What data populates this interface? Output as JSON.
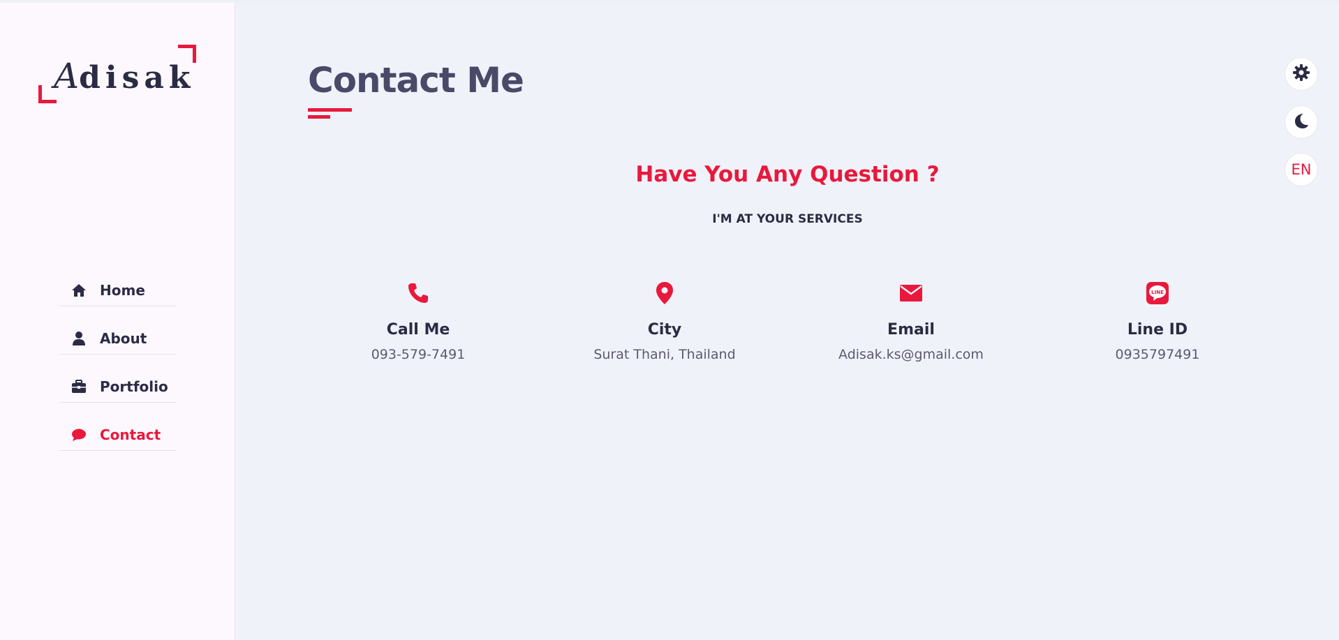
{
  "logo": {
    "first": "A",
    "rest": "disak"
  },
  "nav": [
    {
      "label": "Home",
      "icon": "home-icon",
      "active": false
    },
    {
      "label": "About",
      "icon": "user-icon",
      "active": false
    },
    {
      "label": "Portfolio",
      "icon": "briefcase-icon",
      "active": false
    },
    {
      "label": "Contact",
      "icon": "chat-icon",
      "active": true
    }
  ],
  "main": {
    "title": "Contact Me",
    "question": "Have You Any Question ?",
    "services": "I'M AT YOUR SERVICES"
  },
  "contacts": [
    {
      "icon": "phone-icon",
      "title": "Call Me",
      "value": "093-579-7491"
    },
    {
      "icon": "location-pin-icon",
      "title": "City",
      "value": "Surat Thani, Thailand"
    },
    {
      "icon": "envelope-icon",
      "title": "Email",
      "value": "Adisak.ks@gmail.com"
    },
    {
      "icon": "line-icon",
      "title": "Line ID",
      "value": "0935797491",
      "icon_text": "LINE"
    }
  ],
  "controls": {
    "settings_icon": "gear-icon",
    "theme_icon": "moon-icon",
    "language": "EN"
  },
  "colors": {
    "accent": "#e8193c",
    "text_dark": "#2b2b45",
    "title": "#4b4968",
    "background": "#f0f2fa",
    "sidebar": "#fcf8fd"
  }
}
